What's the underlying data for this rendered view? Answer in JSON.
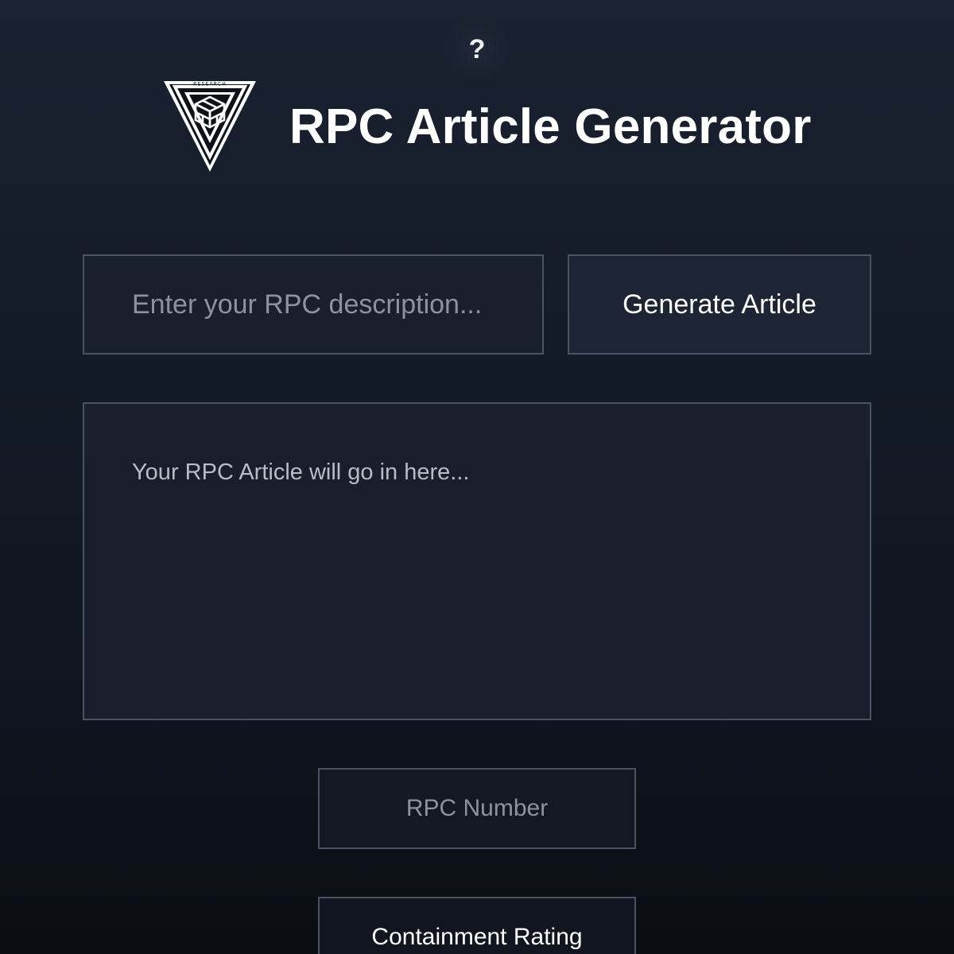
{
  "help": {
    "label": "?"
  },
  "header": {
    "logo_icon": "triangle-cube-logo-icon",
    "logo_text_top": "RESEARCH",
    "title": "RPC Article Generator"
  },
  "form": {
    "description_placeholder": "Enter your RPC description...",
    "description_value": "",
    "generate_label": "Generate Article",
    "article_placeholder": "Your RPC Article will go in here...",
    "rpc_number_placeholder": "RPC Number",
    "containment_label": "Containment Rating"
  },
  "colors": {
    "background_top": "#1a2130",
    "background_bottom": "#0a0d13",
    "border": "#4a5363",
    "text": "#ffffff",
    "placeholder": "#8d939e"
  }
}
